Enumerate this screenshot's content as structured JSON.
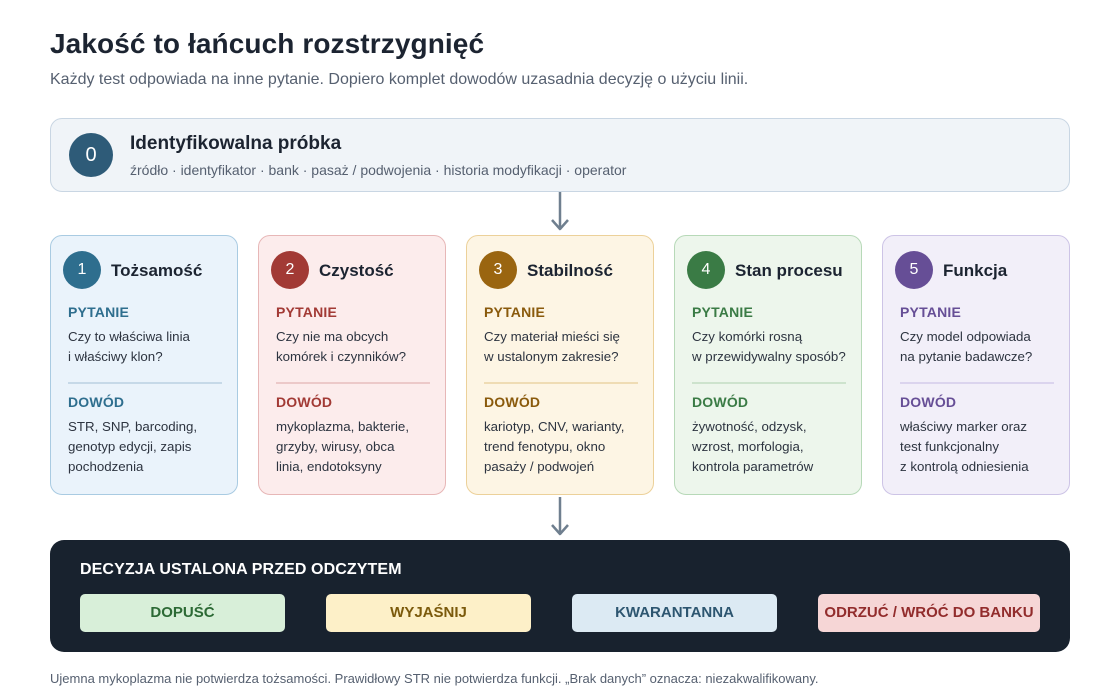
{
  "header": {
    "title": "Jakość to łańcuch rozstrzygnięć",
    "subtitle": "Każdy test odpowiada na inne pytanie. Dopiero komplet dowodów uzasadnia decyzję o użyciu linii."
  },
  "sample": {
    "number": "0",
    "title": "Identyfikowalna próbka",
    "items": "źródło · identyfikator · bank · pasaż / podwojenia · historia modyfikacji · operator",
    "color": "#2e5b78"
  },
  "cards": [
    {
      "number": "1",
      "title": "Tożsamość",
      "question_label": "PYTANIE",
      "question": "Czy to właściwa linia\ni właściwy klon?",
      "evidence_label": "DOWÓD",
      "evidence": "STR, SNP, barcoding,\ngenotyp edycji, zapis\npochodzenia",
      "accent": "#2e6e8e",
      "label_color": "#2e6e8e",
      "bg": "#eaf3fb",
      "border": "#a9cbe2",
      "sep": "#c6d9e8"
    },
    {
      "number": "2",
      "title": "Czystość",
      "question_label": "PYTANIE",
      "question": "Czy nie ma obcych\nkomórek i czynników?",
      "evidence_label": "DOWÓD",
      "evidence": "mykoplazma, bakterie,\ngrzyby, wirusy, obca\nlinia, endotoksyny",
      "accent": "#a23a35",
      "label_color": "#a23a35",
      "bg": "#fcecec",
      "border": "#e7b7b7",
      "sep": "#ecc9c9"
    },
    {
      "number": "3",
      "title": "Stabilność",
      "question_label": "PYTANIE",
      "question": "Czy materiał mieści się\nw ustalonym zakresie?",
      "evidence_label": "DOWÓD",
      "evidence": "kariotyp, CNV, warianty,\ntrend fenotypu, okno\npasaży / podwojeń",
      "accent": "#9a6510",
      "label_color": "#8a5a0c",
      "bg": "#fdf5e4",
      "border": "#ecd19a",
      "sep": "#efdcb4"
    },
    {
      "number": "4",
      "title": "Stan procesu",
      "question_label": "PYTANIE",
      "question": "Czy komórki rosną\nw przewidywalny sposób?",
      "evidence_label": "DOWÓD",
      "evidence": "żywotność, odzysk,\nwzrost, morfologia,\nkontrola parametrów",
      "accent": "#3a7b45",
      "label_color": "#3a7b45",
      "bg": "#edf6ec",
      "border": "#b7d9b8",
      "sep": "#cde3cd"
    },
    {
      "number": "5",
      "title": "Funkcja",
      "question_label": "PYTANIE",
      "question": "Czy model odpowiada\nna pytanie badawcze?",
      "evidence_label": "DOWÓD",
      "evidence": "właściwy marker oraz\ntest funkcjonalny\nz kontrolą odniesienia",
      "accent": "#664e96",
      "label_color": "#664e96",
      "bg": "#f2eff9",
      "border": "#cdc4e6",
      "sep": "#dbd4ee"
    }
  ],
  "decision": {
    "title": "DECYZJA USTALONA PRZED ODCZYTEM",
    "options": [
      {
        "label": "DOPUŚĆ",
        "bg": "#d8efd9",
        "fg": "#2c6a35"
      },
      {
        "label": "WYJAŚNIJ",
        "bg": "#fdf0c8",
        "fg": "#7b5a0c"
      },
      {
        "label": "KWARANTANNA",
        "bg": "#dceaf3",
        "fg": "#2d5670"
      },
      {
        "label": "ODRZUĆ / WRÓĆ DO BANKU",
        "bg": "#f6d6d6",
        "fg": "#922c2c"
      }
    ]
  },
  "footnote": "Ujemna mykoplazma nie potwierdza tożsamości. Prawidłowy STR nie potwierdza funkcji. „Brak danych” oznacza: niezakwalifikowany.",
  "colors": {
    "arrow": "#6f7f8f"
  }
}
